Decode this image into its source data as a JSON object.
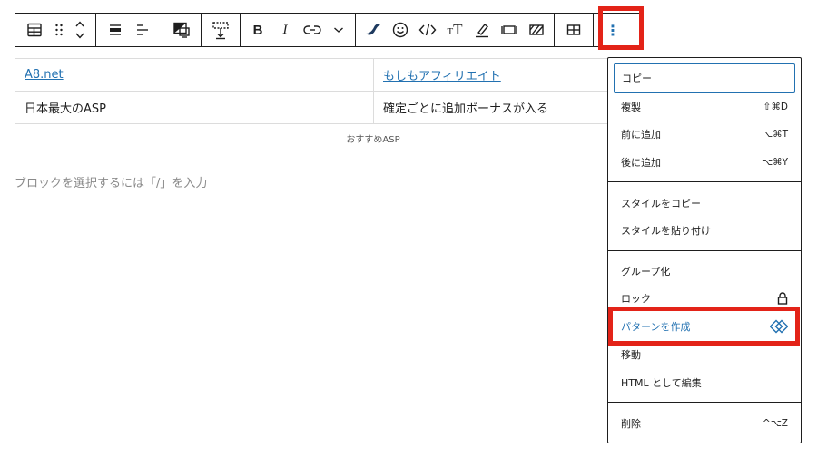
{
  "toolbar": {
    "groups": [
      {
        "buttons": [
          "table-block-icon",
          "drag-handle-icon",
          "move-up-down-icon"
        ]
      },
      {
        "buttons": [
          "align-full-icon",
          "align-left-icon"
        ]
      },
      {
        "buttons": [
          "duotone-icon"
        ]
      },
      {
        "buttons": [
          "spacing-icon"
        ]
      },
      {
        "buttons": [
          "bold-icon",
          "italic-icon",
          "link-icon",
          "chevron-down-icon"
        ]
      },
      {
        "buttons": [
          "wave-icon",
          "emoji-icon",
          "code-icon",
          "font-size-icon",
          "highlight-icon",
          "keyboard-icon",
          "strikethrough-icon"
        ]
      },
      {
        "buttons": [
          "table-edit-icon"
        ]
      },
      {
        "buttons": [
          "more-options-icon"
        ]
      }
    ],
    "bold_label": "B",
    "italic_label": "I",
    "more_label": "⋮",
    "font_size_label": "T"
  },
  "table": {
    "rows": [
      [
        {
          "text": "A8.net",
          "link": true
        },
        {
          "text": "もしもアフィリエイト",
          "link": true
        }
      ],
      [
        {
          "text": "日本最大のASP",
          "link": false
        },
        {
          "text": "確定ごとに追加ボーナスが入る",
          "link": false
        }
      ]
    ],
    "caption": "おすすめASP"
  },
  "editor": {
    "placeholder": "ブロックを選択するには「/」を入力"
  },
  "menu": {
    "items": [
      {
        "label": "コピー",
        "shortcut": ""
      },
      {
        "label": "複製",
        "shortcut": "⇧⌘D"
      },
      {
        "label": "前に追加",
        "shortcut": "⌥⌘T"
      },
      {
        "label": "後に追加",
        "shortcut": "⌥⌘Y"
      },
      {
        "label": "スタイルをコピー",
        "shortcut": ""
      },
      {
        "label": "スタイルを貼り付け",
        "shortcut": ""
      },
      {
        "label": "グループ化",
        "shortcut": ""
      },
      {
        "label": "ロック",
        "shortcut": ""
      },
      {
        "label": "パターンを作成",
        "shortcut": ""
      },
      {
        "label": "移動",
        "shortcut": ""
      },
      {
        "label": "HTML として編集",
        "shortcut": ""
      },
      {
        "label": "削除",
        "shortcut": "^⌥Z"
      }
    ],
    "highlight_color": "#e32318",
    "accent_color": "#2271b1"
  }
}
